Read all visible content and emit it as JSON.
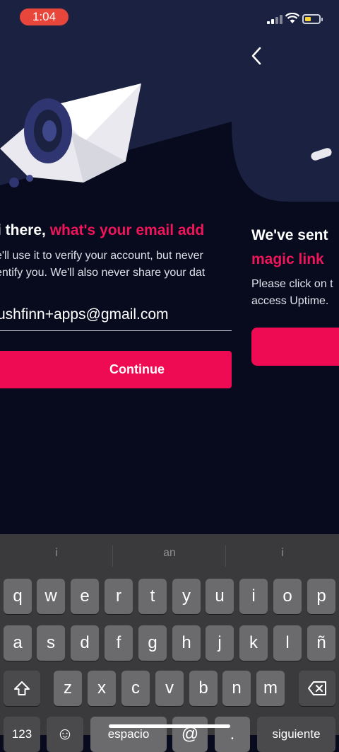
{
  "status_bar": {
    "time": "1:04"
  },
  "slide1": {
    "title_plain": "i there,",
    "title_accent": " what's your email add",
    "description_lines": [
      "e'll use it to verify your account, but never",
      "entify you. We'll also never share your dat"
    ],
    "email_value": "ushfinn+apps@gmail.com",
    "continue_label": "Continue"
  },
  "slide2": {
    "title_line1": "We've sent",
    "title_accent": "magic link",
    "description_lines": [
      "Please click on t",
      "access Uptime."
    ]
  },
  "keyboard": {
    "suggestions": [
      "i",
      "an",
      "i"
    ],
    "row1": [
      "q",
      "w",
      "e",
      "r",
      "t",
      "y",
      "u",
      "i",
      "o",
      "p"
    ],
    "row2": [
      "a",
      "s",
      "d",
      "f",
      "g",
      "h",
      "j",
      "k",
      "l",
      "ñ"
    ],
    "row3": [
      "z",
      "x",
      "c",
      "v",
      "b",
      "n",
      "m"
    ],
    "row4": {
      "numbers": "123",
      "emoji": "☺",
      "space": "espacio",
      "at": "@",
      "dot": ".",
      "next": "siguiente"
    },
    "shift_icon": "shift-icon",
    "delete_icon": "backspace-icon"
  },
  "colors": {
    "accent": "#ee0b53",
    "header_bg": "#1b2140",
    "page_bg": "#070b1d",
    "keyboard_bg": "#3a3a3c"
  }
}
